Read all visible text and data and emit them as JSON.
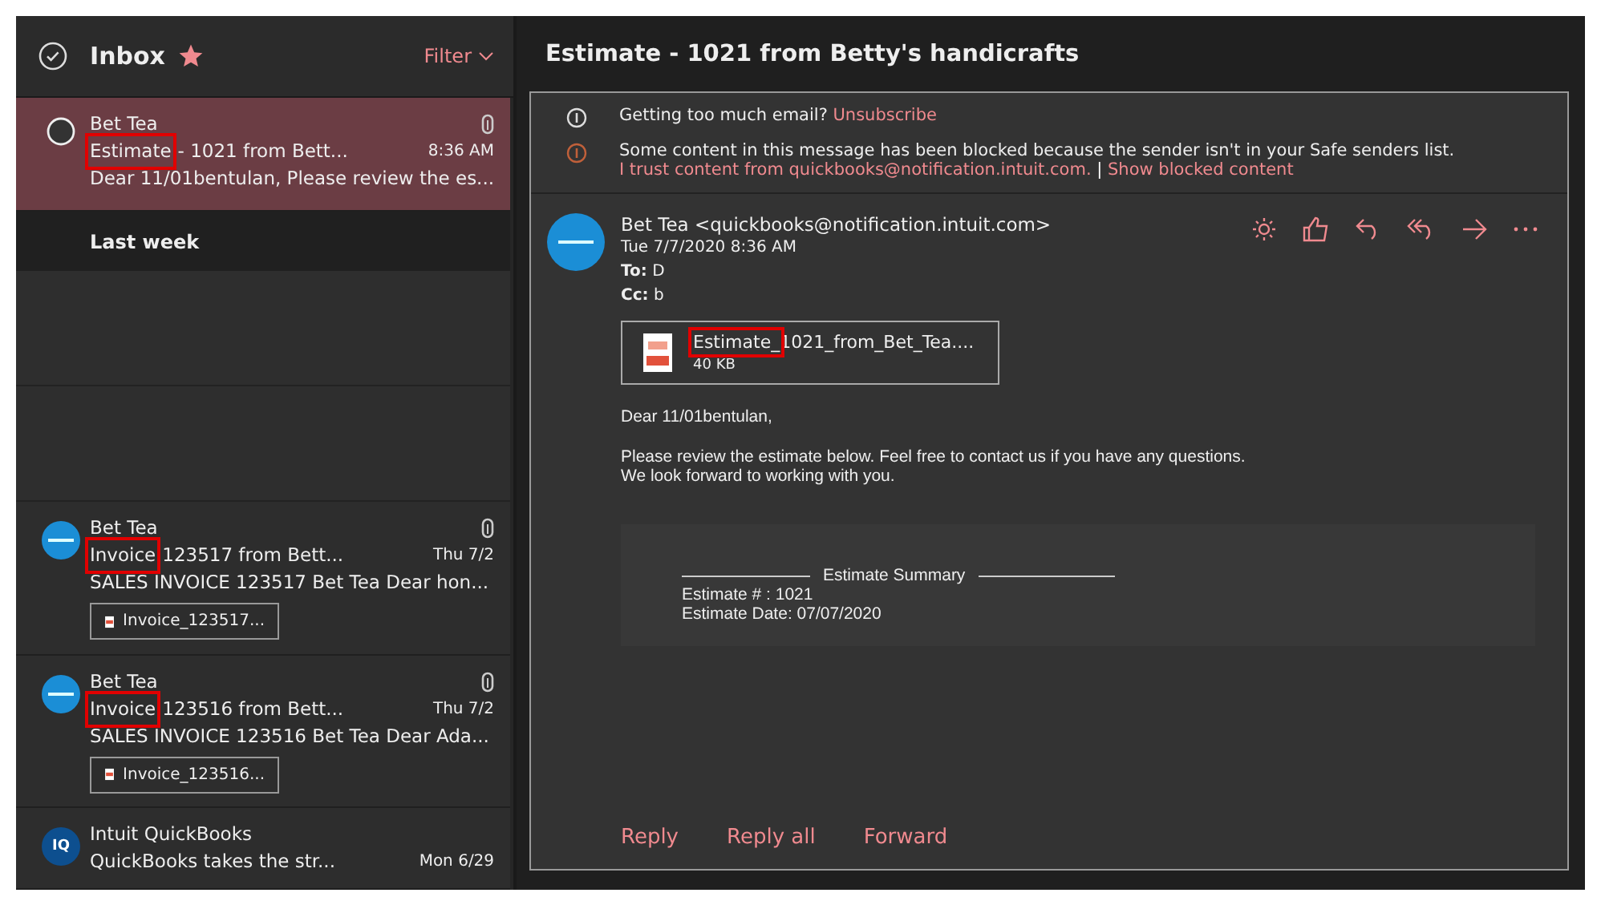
{
  "inbox": {
    "title": "Inbox",
    "filter": "Filter",
    "messages": [
      {
        "kind": "message",
        "selected": true,
        "sender": "Bet Tea",
        "subject_marked": "Estimate",
        "subject_rest": "- 1021 from Bett...",
        "time": "8:36 AM",
        "preview": "Dear 11/01bentulan, Please review the es...",
        "has_attachment": true
      },
      {
        "kind": "group",
        "label": "Last week"
      },
      {
        "kind": "blank"
      },
      {
        "kind": "blank"
      },
      {
        "kind": "message",
        "selected": false,
        "sender": "Bet Tea",
        "subject_marked": "Invoice",
        "subject_rest": "123517 from Bett...",
        "time": "Thu 7/2",
        "preview": "SALES INVOICE 123517 Bet Tea Dear hon...",
        "has_attachment": true,
        "attachment": "Invoice_123517..."
      },
      {
        "kind": "message",
        "selected": false,
        "sender": "Bet Tea",
        "subject_marked": "Invoice",
        "subject_rest": "123516 from Bett...",
        "time": "Thu 7/2",
        "preview": "SALES INVOICE 123516 Bet Tea Dear Ada...",
        "has_attachment": true,
        "attachment": "Invoice_123516..."
      },
      {
        "kind": "message",
        "selected": false,
        "initials": "IQ",
        "sender": "Intuit QuickBooks",
        "subject_rest": "QuickBooks takes the str...",
        "time": "Mon 6/29",
        "has_attachment": false
      }
    ]
  },
  "reading": {
    "title": "Estimate - 1021 from Betty's handicrafts",
    "notices": [
      {
        "kind": "info",
        "text": "Getting too much email?",
        "link": "Unsubscribe"
      },
      {
        "kind": "warning",
        "text": "Some content in this message has been blocked because the sender isn't in your Safe senders list.",
        "link": "I trust content from quickbooks@notification.intuit.com.",
        "separator": "|",
        "link2": "Show blocked content"
      }
    ],
    "sender": "Bet Tea <quickbooks@notification.intuit.com>",
    "date": "Tue 7/7/2020 8:36 AM",
    "to_label": "To:",
    "to": "D",
    "cc_label": "Cc:",
    "cc": "b",
    "attachment": {
      "name_marked": "Estimate_",
      "name_rest": "1021_from_Bet_Tea....",
      "size": "40 KB"
    },
    "body": [
      "Dear 11/01bentulan,",
      "Please review the estimate below. Feel free to contact us if you have any questions.\nWe look forward to working with you."
    ],
    "summary": {
      "heading": "Estimate Summary",
      "lines": [
        "Estimate # : 1021",
        "Estimate Date: 07/07/2020"
      ]
    },
    "actions": [
      "Reply",
      "Reply all",
      "Forward"
    ]
  }
}
